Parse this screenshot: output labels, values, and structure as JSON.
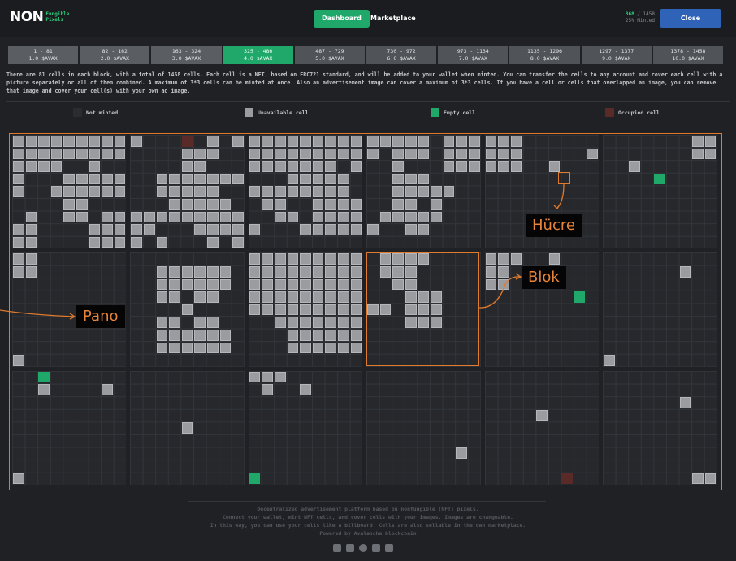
{
  "header": {
    "logo_main": "NON",
    "logo_sub1": "Fungible",
    "logo_sub2": "Pixels",
    "nav_dashboard": "Dashboard",
    "nav_marketplace": "Marketplace",
    "minted_count": "368",
    "minted_total": "/ 1458",
    "minted_pct": "25% Minted",
    "close_label": "Close"
  },
  "price_tabs": [
    {
      "range": "1 - 81",
      "price": "1.0 $AVAX"
    },
    {
      "range": "82 - 162",
      "price": "2.0 $AVAX"
    },
    {
      "range": "163 - 324",
      "price": "3.0 $AVAX"
    },
    {
      "range": "325 - 486",
      "price": "4.0 $AVAX"
    },
    {
      "range": "487 - 729",
      "price": "5.0 $AVAX"
    },
    {
      "range": "730 - 972",
      "price": "6.0 $AVAX"
    },
    {
      "range": "973 - 1134",
      "price": "7.0 $AVAX"
    },
    {
      "range": "1135 - 1296",
      "price": "8.0 $AVAX"
    },
    {
      "range": "1297 - 1377",
      "price": "9.0 $AVAX"
    },
    {
      "range": "1378 - 1458",
      "price": "10.0 $AVAX"
    }
  ],
  "description": "There are 81 cells in each block, with a total of 1458 cells. Each cell is a NFT, based on ERC721 standard, and will be added to your wallet when minted. You can transfer the cells to any account and cover each cell with a picture separately or all of them combined. A maximum of 3*3 cells can be minted at once. Also an advertisement image can cover a maximum of 3*3 cells. If you have a cell or cells that overlapped an image, you can remove that image and cover your cell(s) with your own ad image.",
  "legend": {
    "not_minted": "Not minted",
    "unavailable": "Unavailable cell",
    "empty": "Empty cell",
    "occupied": "Occupied cell"
  },
  "colors": {
    "not_minted": "#2a2c30",
    "unavailable": "#9a9c9f",
    "empty": "#1fa86a",
    "occupied": "#5a2a28",
    "accent_orange": "#e07a2c"
  },
  "annotations": {
    "cell": "Hücre",
    "block": "Blok",
    "board": "Pano"
  },
  "footer": {
    "line1": "Decentralized advertisement platform based on nonfungible (NFT) pixels.",
    "line2": "Connect your wallet, mint NFT cells, and cover cells with your images. Images are changeable.",
    "line3": "In this way, you can use your cells like a billboard. Cells are also sellable in the own marketplace.",
    "line4": "Powered by Avalanche blockchain"
  },
  "board": {
    "blocks": [
      [
        "GGGGGGGGG",
        "GGGGGGGGG",
        "GGGG..G..",
        "G...GGGGG",
        "G..GGGGGG",
        "....GG...",
        ".G..GG.GG",
        "GG....GGG",
        "GG....GGG"
      ],
      [
        "G...O.G.G",
        "....GGG..",
        "....GG...",
        "..GGGGGGG",
        "..GGGGG..",
        "...GGGGG.",
        "GGGGGGGGG",
        "GG...GGGG",
        "G.G...G.G"
      ],
      [
        "GGGGGGGGG",
        "GGGGGGGGG",
        "GGGGGGG.G",
        "...GGGGG.",
        "GGGGGGGG.",
        ".GG..GGGG",
        "..GG.GGGG",
        "G...GGGGG",
        "........."
      ],
      [
        "GGGGG.GGG",
        "G.GGG.GGG",
        "..G...GGG",
        "..GGG....",
        "..GGGGG..",
        "..GG.G...",
        ".GGGGG...",
        "G..GG....",
        "........."
      ],
      [
        "GGG......",
        "GGG.....G",
        "GGG..G...",
        ".........",
        " ........",
        ".........",
        " ........",
        ".........",
        " ........"
      ],
      [
        ".......GG",
        ".......GG",
        "..G......",
        "....E....",
        ".........",
        " ........",
        ".........",
        " ........",
        "........."
      ],
      [
        "GG.......",
        "GG.......",
        ".........",
        " ........",
        ".........",
        " ........",
        ".........",
        " ........",
        "G........"
      ],
      [
        ".........",
        "..GGGGGG.",
        "..GGGGGG.",
        "..GG.GG..",
        "....G....",
        "..GG.GG..",
        "..GGGGGG.",
        "..GGGGGG.",
        "........."
      ],
      [
        "GGGGGGGGG",
        "GGGGGGGGG",
        "GGGGGGGGG",
        "GGGGGGGGG",
        "GGGGGGGGG",
        "..GGGGGGG",
        "...GGGGGG",
        "...GGGGGG",
        "........."
      ],
      [
        ".GGGG....",
        ".GGG.....",
        "..GG.....",
        "...GGG...",
        "GG.GGG...",
        "...GGG...",
        ".........",
        ".........",
        "........."
      ],
      [
        "GGG..G...",
        "GG.......",
        "GG.......",
        ".......E.",
        ".........",
        ".........",
        ".........",
        ".........",
        "........."
      ],
      [
        ".........",
        "......G..",
        ".........",
        ".........",
        ".........",
        ".........",
        ".........",
        ".........",
        "G........"
      ],
      [
        "..E......",
        "..G....G.",
        ".........",
        ".........",
        ".........",
        ".........",
        ".........",
        ".........",
        "G........"
      ],
      [
        ".........",
        ".........",
        ".........",
        ".........",
        "....G....",
        ".........",
        ".........",
        ".........",
        "........."
      ],
      [
        "GGG.....",
        ".G..G....",
        ".........",
        ".........",
        ".........",
        ".........",
        ".........",
        ".........",
        "E........"
      ],
      [
        ".........",
        ".........",
        ".........",
        ".........",
        ".........",
        ".........",
        ".......G.",
        ".........",
        "........."
      ],
      [
        ".........",
        ".........",
        ".........",
        "....G....",
        ".........",
        ".........",
        ".........",
        ".........",
        "......O.."
      ],
      [
        ".........",
        ".........",
        "......G..",
        ".........",
        ".........",
        ".........",
        ".........",
        ".........",
        ".......GG"
      ]
    ]
  }
}
